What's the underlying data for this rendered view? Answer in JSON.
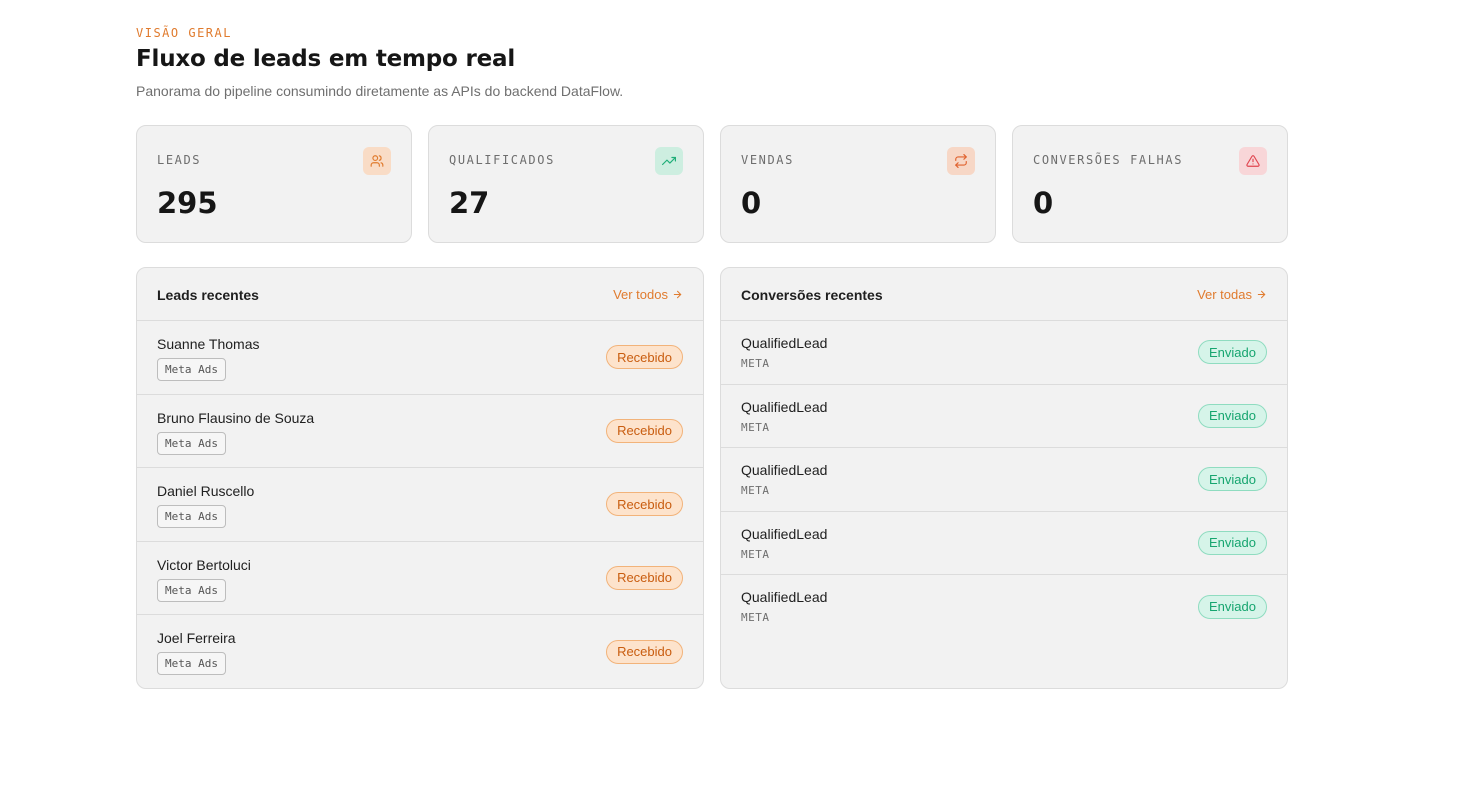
{
  "header": {
    "eyebrow": "VISÃO GERAL",
    "title": "Fluxo de leads em tempo real",
    "subtitle": "Panorama do pipeline consumindo diretamente as APIs do backend DataFlow."
  },
  "stats": [
    {
      "label": "LEADS",
      "value": "295",
      "icon": "users-icon",
      "icon_bg": "#f9dcc6",
      "icon_color": "#e07b2e"
    },
    {
      "label": "QUALIFICADOS",
      "value": "27",
      "icon": "trending-up-icon",
      "icon_bg": "#cdeee0",
      "icon_color": "#1fae78"
    },
    {
      "label": "VENDAS",
      "value": "0",
      "icon": "repeat-icon",
      "icon_bg": "#f7d7c6",
      "icon_color": "#e0622e"
    },
    {
      "label": "CONVERSÕES FALHAS",
      "value": "0",
      "icon": "alert-triangle-icon",
      "icon_bg": "#f8d6d8",
      "icon_color": "#e0454f"
    }
  ],
  "leads_panel": {
    "title": "Leads recentes",
    "link": "Ver todos",
    "items": [
      {
        "name": "Suanne Thomas",
        "source": "Meta Ads",
        "status": "Recebido"
      },
      {
        "name": "Bruno Flausino de Souza",
        "source": "Meta Ads",
        "status": "Recebido"
      },
      {
        "name": "Daniel Ruscello",
        "source": "Meta Ads",
        "status": "Recebido"
      },
      {
        "name": "Victor Bertoluci",
        "source": "Meta Ads",
        "status": "Recebido"
      },
      {
        "name": "Joel Ferreira",
        "source": "Meta Ads",
        "status": "Recebido"
      }
    ]
  },
  "conversions_panel": {
    "title": "Conversões recentes",
    "link": "Ver todas",
    "items": [
      {
        "event": "QualifiedLead",
        "platform": "META",
        "status": "Enviado"
      },
      {
        "event": "QualifiedLead",
        "platform": "META",
        "status": "Enviado"
      },
      {
        "event": "QualifiedLead",
        "platform": "META",
        "status": "Enviado"
      },
      {
        "event": "QualifiedLead",
        "platform": "META",
        "status": "Enviado"
      },
      {
        "event": "QualifiedLead",
        "platform": "META",
        "status": "Enviado"
      }
    ]
  }
}
